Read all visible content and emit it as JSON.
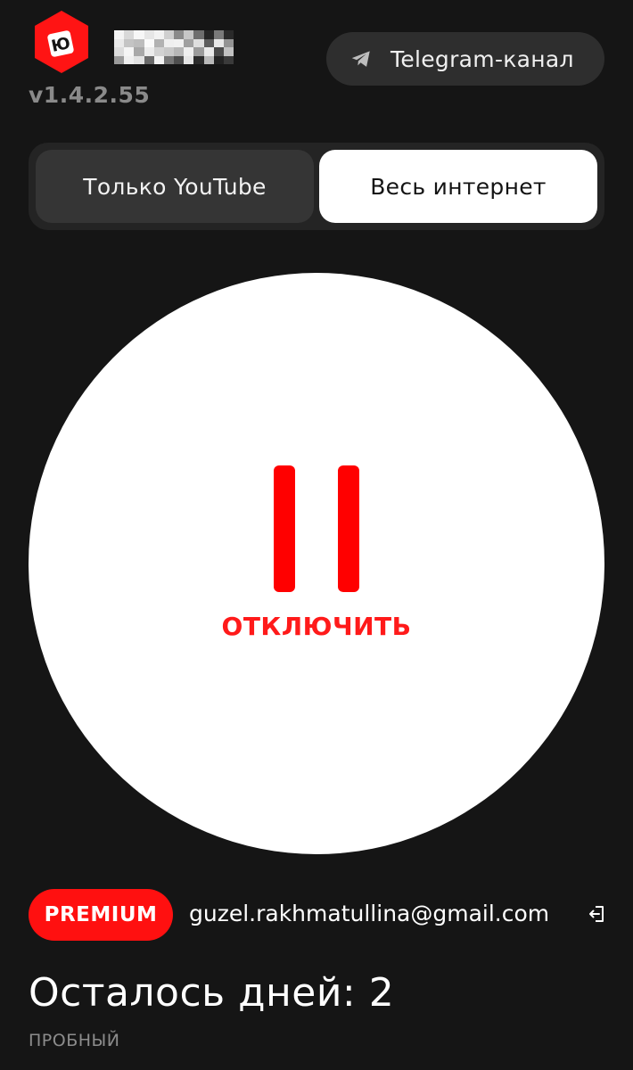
{
  "header": {
    "logo_letter": "Ю",
    "app_name": "[blurred]",
    "version": "v1.4.2.55",
    "telegram_button_label": "Telegram-канал"
  },
  "mode_switch": {
    "options": [
      {
        "label": "Только YouTube",
        "selected": false
      },
      {
        "label": "Весь интернет",
        "selected": true
      }
    ]
  },
  "power_button": {
    "state": "paused",
    "label": "ОТКЛЮЧИТЬ"
  },
  "account": {
    "badge": "PREMIUM",
    "email": "guzel.rakhmatullina@gmail.com",
    "days_left": "Осталось дней: 2",
    "plan": "ПРОБНЫЙ"
  },
  "icons": {
    "logo": "app-logo-hexagon",
    "telegram": "telegram-paper-plane-icon",
    "pause": "pause-icon",
    "logout": "logout-icon"
  },
  "colors": {
    "background": "#151515",
    "accent_red": "#ff1010",
    "surface": "#2e2e2e",
    "muted_text": "#8a8a8a"
  }
}
